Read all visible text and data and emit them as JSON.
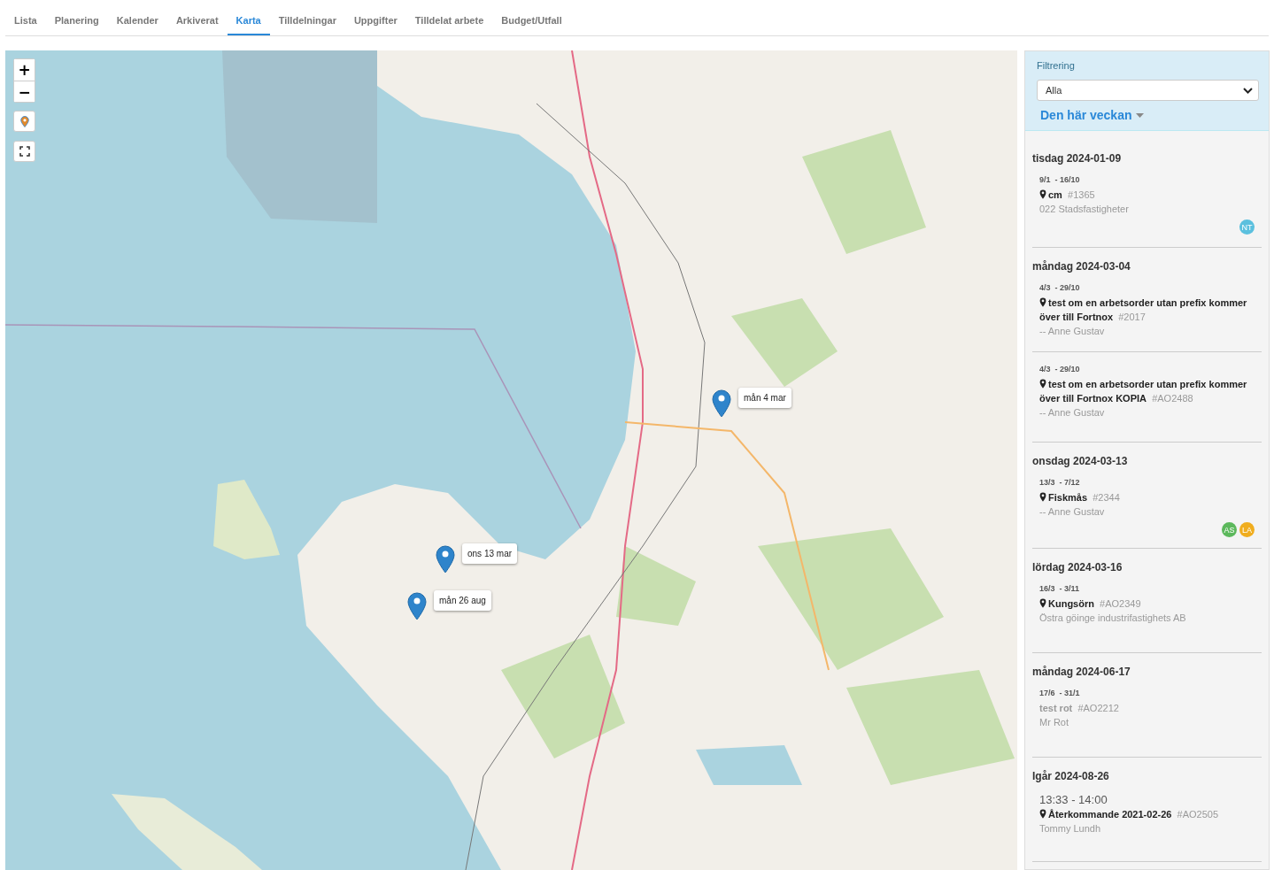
{
  "tabs": [
    {
      "label": "Lista",
      "selected": false
    },
    {
      "label": "Planering",
      "selected": false
    },
    {
      "label": "Kalender",
      "selected": false
    },
    {
      "label": "Arkiverat",
      "selected": false
    },
    {
      "label": "Karta",
      "selected": true
    },
    {
      "label": "Tilldelningar",
      "selected": false
    },
    {
      "label": "Uppgifter",
      "selected": false
    },
    {
      "label": "Tilldelat arbete",
      "selected": false
    },
    {
      "label": "Budget/Utfall",
      "selected": false
    }
  ],
  "map": {
    "zoom_in": "+",
    "zoom_out": "−",
    "markers": [
      {
        "label": "mån 4 mar"
      },
      {
        "label": "ons 13 mar"
      },
      {
        "label": "mån 26 aug"
      }
    ]
  },
  "filter": {
    "title": "Filtrering",
    "select_value": "Alla",
    "period": "Den här veckan"
  },
  "days": [
    {
      "heading": "tisdag 2024-01-09",
      "entries": [
        {
          "kind": "located",
          "range": "9/1  - 16/10",
          "title": "cm",
          "number": "#1365",
          "subtitle": "022 Stadsfastigheter",
          "avatars": [
            {
              "initials": "NT",
              "color": "#5bc0de"
            }
          ]
        }
      ]
    },
    {
      "heading": "måndag 2024-03-04",
      "entries": [
        {
          "kind": "located",
          "range": "4/3  - 29/10",
          "title": "test om en arbetsorder utan prefix kommer över till Fortnox",
          "number": "#2017",
          "subtitle": "-- Anne Gustav"
        },
        {
          "kind": "located",
          "range": "4/3  - 29/10",
          "title": "test om en arbetsorder utan prefix kommer över till Fortnox KOPIA",
          "number": "#AO2488",
          "subtitle": "-- Anne Gustav"
        }
      ]
    },
    {
      "heading": "onsdag 2024-03-13",
      "entries": [
        {
          "kind": "located",
          "range": "13/3  - 7/12",
          "title": "Fiskmås",
          "number": "#2344",
          "subtitle": "-- Anne Gustav",
          "avatars": [
            {
              "initials": "AS",
              "color": "#5cb85c"
            },
            {
              "initials": "LA",
              "color": "#f0ad1e"
            }
          ]
        }
      ]
    },
    {
      "heading": "lördag 2024-03-16",
      "entries": [
        {
          "kind": "located",
          "range": "16/3  - 3/11",
          "title": "Kungsörn",
          "number": "#AO2349",
          "subtitle": "Östra göinge industrifastighets AB"
        }
      ]
    },
    {
      "heading": "måndag 2024-06-17",
      "entries": [
        {
          "kind": "plain",
          "range": "17/6  - 31/1",
          "title": "test rot",
          "number": "#AO2212",
          "subtitle": "Mr Rot"
        }
      ]
    },
    {
      "heading": "Igår 2024-08-26",
      "entries": [
        {
          "kind": "timed",
          "range": "13:33 - 14:00",
          "title": "Återkommande 2021-02-26",
          "number": "#AO2505",
          "subtitle": "Tommy Lundh"
        }
      ]
    }
  ]
}
